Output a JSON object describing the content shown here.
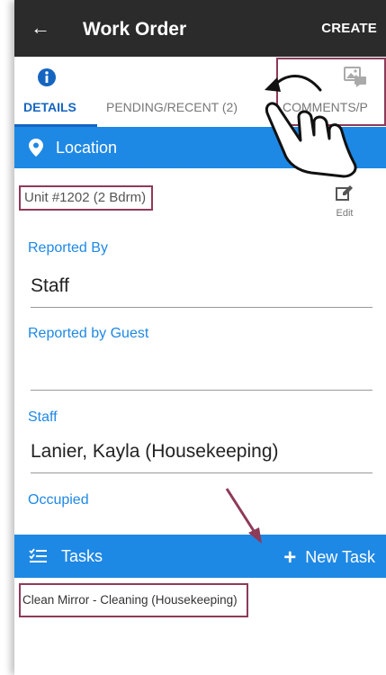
{
  "header": {
    "back_glyph": "←",
    "title": "Work Order",
    "create_label": "CREATE"
  },
  "tabs": [
    {
      "label": "DETAILS",
      "icon": "info-icon",
      "active": true
    },
    {
      "label": "PENDING/RECENT (2)",
      "active": false
    },
    {
      "label": "COMMENTS/P",
      "icon": "image-comment-icon",
      "active": false
    }
  ],
  "location": {
    "section_label": "Location",
    "unit": "Unit #1202 (2 Bdrm)",
    "edit_label": "Edit"
  },
  "fields": {
    "reported_by_label": "Reported By",
    "reported_by_value": "Staff",
    "reported_by_guest_label": "Reported by Guest",
    "reported_by_guest_value": "",
    "staff_label": "Staff",
    "staff_value": "Lanier, Kayla (Housekeeping)",
    "occupied_label": "Occupied"
  },
  "tasks": {
    "section_label": "Tasks",
    "new_task_label": "New Task",
    "items": [
      {
        "label": "Clean Mirror - Cleaning (Housekeeping)"
      }
    ]
  },
  "colors": {
    "appbar": "#2b2b2b",
    "accent": "#1e88e5",
    "active_tab": "#1565c0",
    "highlight": "#8e3a59"
  }
}
